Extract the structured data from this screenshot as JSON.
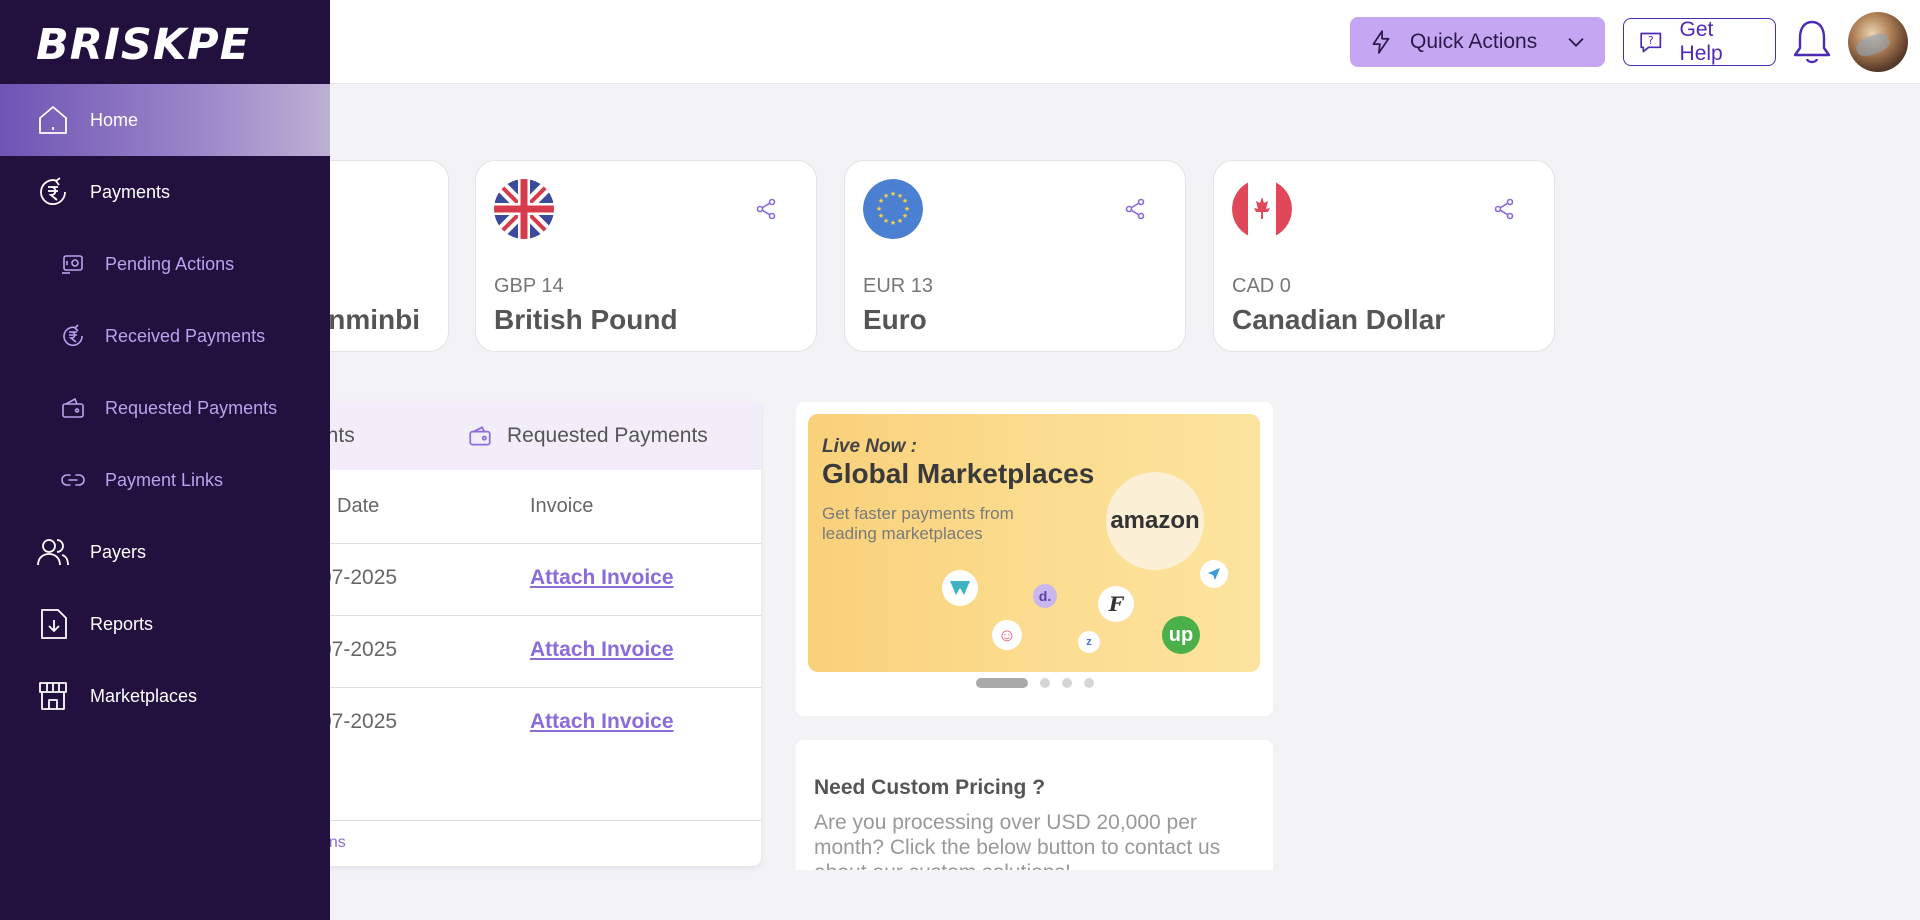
{
  "header": {
    "quick_actions_label": "Quick Actions",
    "get_help_label": "Get Help"
  },
  "sidebar": {
    "logo": "BRISKPE",
    "items": [
      {
        "label": "Home"
      },
      {
        "label": "Payments"
      },
      {
        "label": "Pending Actions"
      },
      {
        "label": "Received Payments"
      },
      {
        "label": "Requested Payments"
      },
      {
        "label": "Payment Links"
      },
      {
        "label": "Payers"
      },
      {
        "label": "Reports"
      },
      {
        "label": "Marketplaces"
      }
    ]
  },
  "currency_cards": [
    {
      "amount": "",
      "name": "nminbi"
    },
    {
      "amount": "GBP 14",
      "name": "British Pound"
    },
    {
      "amount": "EUR 13",
      "name": "Euro"
    },
    {
      "amount": "CAD 0",
      "name": "Canadian Dollar"
    }
  ],
  "payments_table": {
    "tabs": [
      {
        "label": "ents"
      },
      {
        "label": "Requested Payments"
      }
    ],
    "columns": {
      "date": "Date",
      "invoice": "Invoice"
    },
    "rows": [
      {
        "date": "07-2025",
        "invoice": "Attach Invoice"
      },
      {
        "date": "07-2025",
        "invoice": "Attach Invoice"
      },
      {
        "date": "07-2025",
        "invoice": "Attach Invoice"
      }
    ],
    "footer_link": "ons"
  },
  "banner": {
    "live_label": "Live Now :",
    "title": "Global Marketplaces",
    "subtitle": "Get faster payments from leading marketplaces",
    "amazon_text": "amazon",
    "slide_count": 4,
    "active_slide": 1
  },
  "pricing": {
    "title": "Need Custom Pricing ?",
    "text": "Are you processing over USD 20,000 per month? Click the below button to contact us about our custom solutions!"
  },
  "colors": {
    "sidebar_bg": "#22103f",
    "accent": "#4b2bb5",
    "quick_actions_bg": "#c5a6f3",
    "link": "#8b6bd9"
  }
}
